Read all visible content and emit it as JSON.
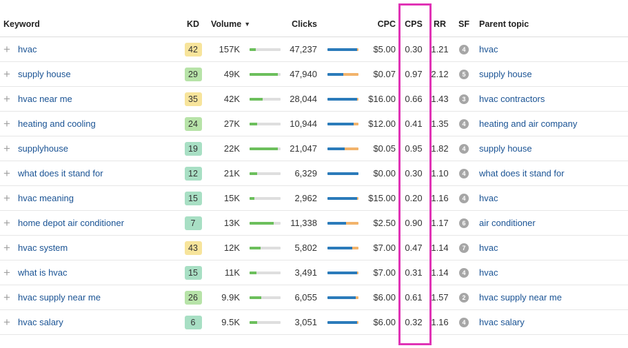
{
  "columns": {
    "keyword": "Keyword",
    "kd": "KD",
    "volume": "Volume",
    "clicks": "Clicks",
    "cpc": "CPC",
    "cps": "CPS",
    "rr": "RR",
    "sf": "SF",
    "parent_topic": "Parent topic"
  },
  "icons": {
    "add": "plus-icon",
    "sort": "caret-down-icon"
  },
  "colors": {
    "link": "#1a5394",
    "kd_yellow": "#f7e49b",
    "kd_green": "#b7e3a8",
    "kd_teal": "#a8dfc4",
    "volume_bar": "#6cbf5c",
    "clicks_paid": "#2b7bba",
    "clicks_organic": "#f2b36b",
    "highlight": "#e033b5"
  },
  "rows": [
    {
      "keyword": "hvac",
      "kd": "42",
      "kd_level": "yellow",
      "volume": "157K",
      "volume_frac": 0.2,
      "clicks": "47,237",
      "clicks_blue_frac": 0.95,
      "cpc": "$5.00",
      "cps": "0.30",
      "rr": "1.21",
      "sf": "4",
      "parent": "hvac"
    },
    {
      "keyword": "supply house",
      "kd": "29",
      "kd_level": "green",
      "volume": "49K",
      "volume_frac": 0.92,
      "clicks": "47,940",
      "clicks_blue_frac": 0.5,
      "cpc": "$0.07",
      "cps": "0.97",
      "rr": "2.12",
      "sf": "5",
      "parent": "supply house"
    },
    {
      "keyword": "hvac near me",
      "kd": "35",
      "kd_level": "yellow",
      "volume": "42K",
      "volume_frac": 0.42,
      "clicks": "28,044",
      "clicks_blue_frac": 0.95,
      "cpc": "$16.00",
      "cps": "0.66",
      "rr": "1.43",
      "sf": "3",
      "parent": "hvac contractors"
    },
    {
      "keyword": "heating and cooling",
      "kd": "24",
      "kd_level": "green",
      "volume": "27K",
      "volume_frac": 0.25,
      "clicks": "10,944",
      "clicks_blue_frac": 0.85,
      "cpc": "$12.00",
      "cps": "0.41",
      "rr": "1.35",
      "sf": "4",
      "parent": "heating and air company"
    },
    {
      "keyword": "supplyhouse",
      "kd": "19",
      "kd_level": "teal",
      "volume": "22K",
      "volume_frac": 0.9,
      "clicks": "21,047",
      "clicks_blue_frac": 0.55,
      "cpc": "$0.05",
      "cps": "0.95",
      "rr": "1.82",
      "sf": "4",
      "parent": "supply house"
    },
    {
      "keyword": "what does it stand for",
      "kd": "12",
      "kd_level": "teal",
      "volume": "21K",
      "volume_frac": 0.25,
      "clicks": "6,329",
      "clicks_blue_frac": 1.0,
      "cpc": "$0.00",
      "cps": "0.30",
      "rr": "1.10",
      "sf": "4",
      "parent": "what does it stand for"
    },
    {
      "keyword": "hvac meaning",
      "kd": "15",
      "kd_level": "teal",
      "volume": "15K",
      "volume_frac": 0.15,
      "clicks": "2,962",
      "clicks_blue_frac": 0.95,
      "cpc": "$15.00",
      "cps": "0.20",
      "rr": "1.16",
      "sf": "4",
      "parent": "hvac"
    },
    {
      "keyword": "home depot air conditioner",
      "kd": "7",
      "kd_level": "teal",
      "volume": "13K",
      "volume_frac": 0.78,
      "clicks": "11,338",
      "clicks_blue_frac": 0.6,
      "cpc": "$2.50",
      "cps": "0.90",
      "rr": "1.17",
      "sf": "6",
      "parent": "air conditioner"
    },
    {
      "keyword": "hvac system",
      "kd": "43",
      "kd_level": "yellow",
      "volume": "12K",
      "volume_frac": 0.35,
      "clicks": "5,802",
      "clicks_blue_frac": 0.8,
      "cpc": "$7.00",
      "cps": "0.47",
      "rr": "1.14",
      "sf": "7",
      "parent": "hvac"
    },
    {
      "keyword": "what is hvac",
      "kd": "15",
      "kd_level": "teal",
      "volume": "11K",
      "volume_frac": 0.22,
      "clicks": "3,491",
      "clicks_blue_frac": 0.95,
      "cpc": "$7.00",
      "cps": "0.31",
      "rr": "1.14",
      "sf": "4",
      "parent": "hvac"
    },
    {
      "keyword": "hvac supply near me",
      "kd": "26",
      "kd_level": "green",
      "volume": "9.9K",
      "volume_frac": 0.38,
      "clicks": "6,055",
      "clicks_blue_frac": 0.92,
      "cpc": "$6.00",
      "cps": "0.61",
      "rr": "1.57",
      "sf": "2",
      "parent": "hvac supply near me"
    },
    {
      "keyword": "hvac salary",
      "kd": "6",
      "kd_level": "teal",
      "volume": "9.5K",
      "volume_frac": 0.25,
      "clicks": "3,051",
      "clicks_blue_frac": 0.95,
      "cpc": "$6.00",
      "cps": "0.32",
      "rr": "1.16",
      "sf": "4",
      "parent": "hvac salary"
    }
  ]
}
